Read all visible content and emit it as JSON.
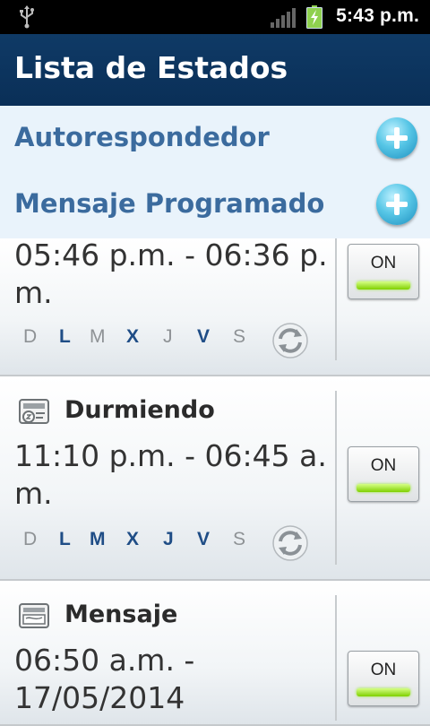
{
  "status_bar": {
    "time": "5:43 p.m."
  },
  "app": {
    "title": "Lista de Estados"
  },
  "sections": [
    {
      "label": "Autorespondedor"
    },
    {
      "label": "Mensaje Programado"
    }
  ],
  "items": [
    {
      "name": "",
      "time": "05:46 p.m. - 06:36 p. m.",
      "days": [
        {
          "label": "D",
          "active": false
        },
        {
          "label": "L",
          "active": true
        },
        {
          "label": "M",
          "active": false
        },
        {
          "label": "X",
          "active": true
        },
        {
          "label": "J",
          "active": false
        },
        {
          "label": "V",
          "active": true
        },
        {
          "label": "S",
          "active": false
        }
      ],
      "toggle": "ON"
    },
    {
      "name": "Durmiendo",
      "time": "11:10 p.m. - 06:45 a. m.",
      "days": [
        {
          "label": "D",
          "active": false
        },
        {
          "label": "L",
          "active": true
        },
        {
          "label": "M",
          "active": true
        },
        {
          "label": "X",
          "active": true
        },
        {
          "label": "J",
          "active": true
        },
        {
          "label": "V",
          "active": true
        },
        {
          "label": "S",
          "active": false
        }
      ],
      "toggle": "ON"
    },
    {
      "name": "Mensaje",
      "time": "06:50 a.m. - 17/05/2014",
      "toggle": "ON"
    }
  ]
}
